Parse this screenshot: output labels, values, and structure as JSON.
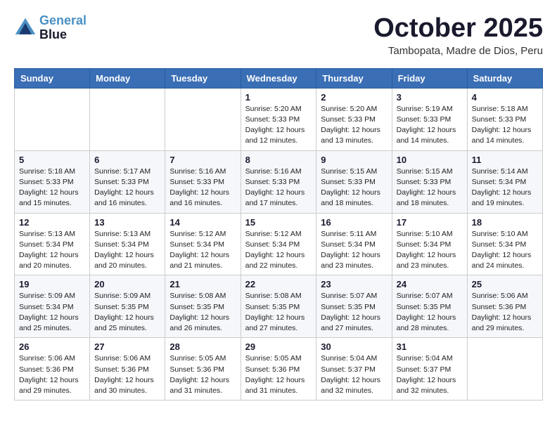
{
  "header": {
    "logo_line1": "General",
    "logo_line2": "Blue",
    "month": "October 2025",
    "location": "Tambopata, Madre de Dios, Peru"
  },
  "days_of_week": [
    "Sunday",
    "Monday",
    "Tuesday",
    "Wednesday",
    "Thursday",
    "Friday",
    "Saturday"
  ],
  "weeks": [
    [
      {
        "day": "",
        "info": ""
      },
      {
        "day": "",
        "info": ""
      },
      {
        "day": "",
        "info": ""
      },
      {
        "day": "1",
        "info": "Sunrise: 5:20 AM\nSunset: 5:33 PM\nDaylight: 12 hours\nand 12 minutes."
      },
      {
        "day": "2",
        "info": "Sunrise: 5:20 AM\nSunset: 5:33 PM\nDaylight: 12 hours\nand 13 minutes."
      },
      {
        "day": "3",
        "info": "Sunrise: 5:19 AM\nSunset: 5:33 PM\nDaylight: 12 hours\nand 14 minutes."
      },
      {
        "day": "4",
        "info": "Sunrise: 5:18 AM\nSunset: 5:33 PM\nDaylight: 12 hours\nand 14 minutes."
      }
    ],
    [
      {
        "day": "5",
        "info": "Sunrise: 5:18 AM\nSunset: 5:33 PM\nDaylight: 12 hours\nand 15 minutes."
      },
      {
        "day": "6",
        "info": "Sunrise: 5:17 AM\nSunset: 5:33 PM\nDaylight: 12 hours\nand 16 minutes."
      },
      {
        "day": "7",
        "info": "Sunrise: 5:16 AM\nSunset: 5:33 PM\nDaylight: 12 hours\nand 16 minutes."
      },
      {
        "day": "8",
        "info": "Sunrise: 5:16 AM\nSunset: 5:33 PM\nDaylight: 12 hours\nand 17 minutes."
      },
      {
        "day": "9",
        "info": "Sunrise: 5:15 AM\nSunset: 5:33 PM\nDaylight: 12 hours\nand 18 minutes."
      },
      {
        "day": "10",
        "info": "Sunrise: 5:15 AM\nSunset: 5:33 PM\nDaylight: 12 hours\nand 18 minutes."
      },
      {
        "day": "11",
        "info": "Sunrise: 5:14 AM\nSunset: 5:34 PM\nDaylight: 12 hours\nand 19 minutes."
      }
    ],
    [
      {
        "day": "12",
        "info": "Sunrise: 5:13 AM\nSunset: 5:34 PM\nDaylight: 12 hours\nand 20 minutes."
      },
      {
        "day": "13",
        "info": "Sunrise: 5:13 AM\nSunset: 5:34 PM\nDaylight: 12 hours\nand 20 minutes."
      },
      {
        "day": "14",
        "info": "Sunrise: 5:12 AM\nSunset: 5:34 PM\nDaylight: 12 hours\nand 21 minutes."
      },
      {
        "day": "15",
        "info": "Sunrise: 5:12 AM\nSunset: 5:34 PM\nDaylight: 12 hours\nand 22 minutes."
      },
      {
        "day": "16",
        "info": "Sunrise: 5:11 AM\nSunset: 5:34 PM\nDaylight: 12 hours\nand 23 minutes."
      },
      {
        "day": "17",
        "info": "Sunrise: 5:10 AM\nSunset: 5:34 PM\nDaylight: 12 hours\nand 23 minutes."
      },
      {
        "day": "18",
        "info": "Sunrise: 5:10 AM\nSunset: 5:34 PM\nDaylight: 12 hours\nand 24 minutes."
      }
    ],
    [
      {
        "day": "19",
        "info": "Sunrise: 5:09 AM\nSunset: 5:34 PM\nDaylight: 12 hours\nand 25 minutes."
      },
      {
        "day": "20",
        "info": "Sunrise: 5:09 AM\nSunset: 5:35 PM\nDaylight: 12 hours\nand 25 minutes."
      },
      {
        "day": "21",
        "info": "Sunrise: 5:08 AM\nSunset: 5:35 PM\nDaylight: 12 hours\nand 26 minutes."
      },
      {
        "day": "22",
        "info": "Sunrise: 5:08 AM\nSunset: 5:35 PM\nDaylight: 12 hours\nand 27 minutes."
      },
      {
        "day": "23",
        "info": "Sunrise: 5:07 AM\nSunset: 5:35 PM\nDaylight: 12 hours\nand 27 minutes."
      },
      {
        "day": "24",
        "info": "Sunrise: 5:07 AM\nSunset: 5:35 PM\nDaylight: 12 hours\nand 28 minutes."
      },
      {
        "day": "25",
        "info": "Sunrise: 5:06 AM\nSunset: 5:36 PM\nDaylight: 12 hours\nand 29 minutes."
      }
    ],
    [
      {
        "day": "26",
        "info": "Sunrise: 5:06 AM\nSunset: 5:36 PM\nDaylight: 12 hours\nand 29 minutes."
      },
      {
        "day": "27",
        "info": "Sunrise: 5:06 AM\nSunset: 5:36 PM\nDaylight: 12 hours\nand 30 minutes."
      },
      {
        "day": "28",
        "info": "Sunrise: 5:05 AM\nSunset: 5:36 PM\nDaylight: 12 hours\nand 31 minutes."
      },
      {
        "day": "29",
        "info": "Sunrise: 5:05 AM\nSunset: 5:36 PM\nDaylight: 12 hours\nand 31 minutes."
      },
      {
        "day": "30",
        "info": "Sunrise: 5:04 AM\nSunset: 5:37 PM\nDaylight: 12 hours\nand 32 minutes."
      },
      {
        "day": "31",
        "info": "Sunrise: 5:04 AM\nSunset: 5:37 PM\nDaylight: 12 hours\nand 32 minutes."
      },
      {
        "day": "",
        "info": ""
      }
    ]
  ]
}
